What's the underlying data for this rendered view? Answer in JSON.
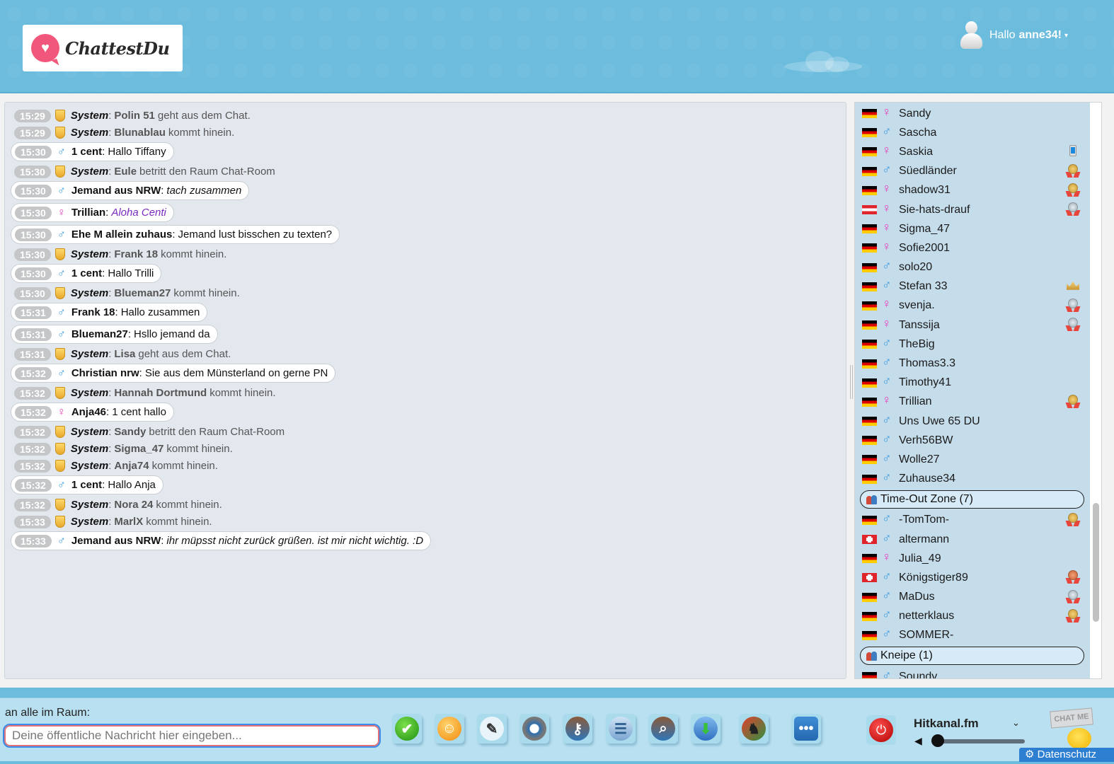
{
  "header": {
    "logo_text": "ChattestDu",
    "greeting": "Hallo",
    "username": "anne34!"
  },
  "messages": [
    {
      "time": "15:29",
      "type": "system",
      "sender": "System",
      "name": "Polin 51",
      "rest": "geht aus dem Chat."
    },
    {
      "time": "15:29",
      "type": "system",
      "sender": "System",
      "name": "Blunablau",
      "rest": "kommt hinein."
    },
    {
      "time": "15:30",
      "type": "user",
      "gender": "male",
      "sender": "1 cent",
      "text": "Hallo Tiffany",
      "style": ""
    },
    {
      "time": "15:30",
      "type": "system",
      "sender": "System",
      "name": "Eule",
      "rest": "betritt den Raum Chat-Room"
    },
    {
      "time": "15:30",
      "type": "user",
      "gender": "male",
      "sender": "Jemand aus NRW",
      "text": "tach zusammen",
      "style": "italic"
    },
    {
      "time": "15:30",
      "type": "user",
      "gender": "female",
      "sender": "Trillian",
      "text": "Aloha Centi",
      "style": "italic purple"
    },
    {
      "time": "15:30",
      "type": "user",
      "gender": "male",
      "sender": "Ehe M allein zuhaus",
      "text": "Jemand lust bisschen zu texten?",
      "style": ""
    },
    {
      "time": "15:30",
      "type": "system",
      "sender": "System",
      "name": "Frank 18",
      "rest": "kommt hinein."
    },
    {
      "time": "15:30",
      "type": "user",
      "gender": "male",
      "sender": "1 cent",
      "text": "Hallo Trilli",
      "style": ""
    },
    {
      "time": "15:30",
      "type": "system",
      "sender": "System",
      "name": "Blueman27",
      "rest": "kommt hinein."
    },
    {
      "time": "15:31",
      "type": "user",
      "gender": "male",
      "sender": "Frank 18",
      "text": "Hallo zusammen",
      "style": ""
    },
    {
      "time": "15:31",
      "type": "user",
      "gender": "male",
      "sender": "Blueman27",
      "text": "Hsllo jemand da",
      "style": ""
    },
    {
      "time": "15:31",
      "type": "system",
      "sender": "System",
      "name": "Lisa",
      "rest": "geht aus dem Chat."
    },
    {
      "time": "15:32",
      "type": "user",
      "gender": "male",
      "sender": "Christian nrw",
      "text": "Sie aus dem Münsterland on gerne PN",
      "style": ""
    },
    {
      "time": "15:32",
      "type": "system",
      "sender": "System",
      "name": "Hannah Dortmund",
      "rest": "kommt hinein."
    },
    {
      "time": "15:32",
      "type": "user",
      "gender": "female",
      "sender": "Anja46",
      "text": "1 cent hallo",
      "style": ""
    },
    {
      "time": "15:32",
      "type": "system",
      "sender": "System",
      "name": "Sandy",
      "rest": "betritt den Raum Chat-Room"
    },
    {
      "time": "15:32",
      "type": "system",
      "sender": "System",
      "name": "Sigma_47",
      "rest": "kommt hinein."
    },
    {
      "time": "15:32",
      "type": "system",
      "sender": "System",
      "name": "Anja74",
      "rest": "kommt hinein."
    },
    {
      "time": "15:32",
      "type": "user",
      "gender": "male",
      "sender": "1 cent",
      "text": "Hallo Anja",
      "style": ""
    },
    {
      "time": "15:32",
      "type": "system",
      "sender": "System",
      "name": "Nora 24",
      "rest": "kommt hinein."
    },
    {
      "time": "15:33",
      "type": "system",
      "sender": "System",
      "name": "MarlX",
      "rest": "kommt hinein."
    },
    {
      "time": "15:33",
      "type": "user",
      "gender": "male",
      "sender": "Jemand aus NRW",
      "text": "ihr müpsst nicht zurück grüßen. ist mir nicht wichtig. :D",
      "style": "italic"
    }
  ],
  "userlist": [
    {
      "kind": "user",
      "flag": "de",
      "gender": "female",
      "name": "Sandy",
      "badge": ""
    },
    {
      "kind": "user",
      "flag": "de",
      "gender": "male",
      "name": "Sascha",
      "badge": ""
    },
    {
      "kind": "user",
      "flag": "de",
      "gender": "female",
      "name": "Saskia",
      "badge": "mobile"
    },
    {
      "kind": "user",
      "flag": "de",
      "gender": "male",
      "name": "Süedländer",
      "badge": "gold-medal"
    },
    {
      "kind": "user",
      "flag": "de",
      "gender": "female",
      "name": "shadow31",
      "badge": "gold-medal"
    },
    {
      "kind": "user",
      "flag": "at",
      "gender": "female",
      "name": "Sie-hats-drauf",
      "badge": "silver-medal"
    },
    {
      "kind": "user",
      "flag": "de",
      "gender": "female",
      "name": "Sigma_47",
      "badge": ""
    },
    {
      "kind": "user",
      "flag": "de",
      "gender": "female",
      "name": "Sofie2001",
      "badge": ""
    },
    {
      "kind": "user",
      "flag": "de",
      "gender": "male",
      "name": "solo20",
      "badge": ""
    },
    {
      "kind": "user",
      "flag": "de",
      "gender": "male",
      "name": "Stefan 33",
      "badge": "crown"
    },
    {
      "kind": "user",
      "flag": "de",
      "gender": "female",
      "name": "svenja.",
      "badge": "silver-medal"
    },
    {
      "kind": "user",
      "flag": "de",
      "gender": "female",
      "name": "Tanssija",
      "badge": "silver-medal"
    },
    {
      "kind": "user",
      "flag": "de",
      "gender": "male",
      "name": "TheBig",
      "badge": ""
    },
    {
      "kind": "user",
      "flag": "de",
      "gender": "male",
      "name": "Thomas3.3",
      "badge": ""
    },
    {
      "kind": "user",
      "flag": "de",
      "gender": "male",
      "name": "Timothy41",
      "badge": ""
    },
    {
      "kind": "user",
      "flag": "de",
      "gender": "female",
      "name": "Trillian",
      "badge": "gold-medal"
    },
    {
      "kind": "user",
      "flag": "de",
      "gender": "male",
      "name": "Uns Uwe 65 DU",
      "badge": ""
    },
    {
      "kind": "user",
      "flag": "de",
      "gender": "male",
      "name": "Verh56BW",
      "badge": ""
    },
    {
      "kind": "user",
      "flag": "de",
      "gender": "male",
      "name": "Wolle27",
      "badge": ""
    },
    {
      "kind": "user",
      "flag": "de",
      "gender": "male",
      "name": "Zuhause34",
      "badge": ""
    },
    {
      "kind": "room",
      "name": "Time-Out Zone (7)"
    },
    {
      "kind": "user",
      "flag": "de",
      "gender": "male",
      "name": "-TomTom-",
      "badge": "gold-medal"
    },
    {
      "kind": "user",
      "flag": "ch",
      "gender": "male",
      "name": "altermann",
      "badge": ""
    },
    {
      "kind": "user",
      "flag": "de",
      "gender": "female",
      "name": "Julia_49",
      "badge": ""
    },
    {
      "kind": "user",
      "flag": "ch",
      "gender": "male",
      "name": "Königstiger89",
      "badge": "bronze-medal"
    },
    {
      "kind": "user",
      "flag": "de",
      "gender": "male",
      "name": "MaDus",
      "badge": "silver-medal"
    },
    {
      "kind": "user",
      "flag": "de",
      "gender": "male",
      "name": "netterklaus",
      "badge": "gold-medal"
    },
    {
      "kind": "user",
      "flag": "de",
      "gender": "male",
      "name": "SOMMER-",
      "badge": ""
    },
    {
      "kind": "room",
      "name": "Kneipe (1)"
    },
    {
      "kind": "user",
      "flag": "de",
      "gender": "male",
      "name": "Soundy",
      "badge": ""
    }
  ],
  "footer": {
    "recipient_label": "an alle im Raum:",
    "input_placeholder": "Deine öffentliche Nachricht hier eingeben...",
    "input_value": "",
    "tools": [
      {
        "icon": "send-check-icon"
      },
      {
        "icon": "smiley-icon"
      },
      {
        "icon": "color-pencil-icon"
      },
      {
        "icon": "settings-gear-icon"
      },
      {
        "icon": "users-key-icon"
      },
      {
        "icon": "address-book-icon"
      },
      {
        "icon": "user-search-icon"
      },
      {
        "icon": "folder-download-icon"
      },
      {
        "icon": "games-icon"
      },
      {
        "icon": "chat-bubbles-icon"
      }
    ],
    "radio": {
      "station": "Hitkanal.fm",
      "volume_percent": 0
    },
    "chat_me_label": "CHAT ME",
    "privacy_label": "Datenschutz"
  },
  "colors": {
    "header_bg": "#6bbcdd",
    "userlist_bg": "#c5dcea",
    "male": "#3a9be0",
    "female": "#e83fbf",
    "logo_accent": "#f0577a"
  }
}
